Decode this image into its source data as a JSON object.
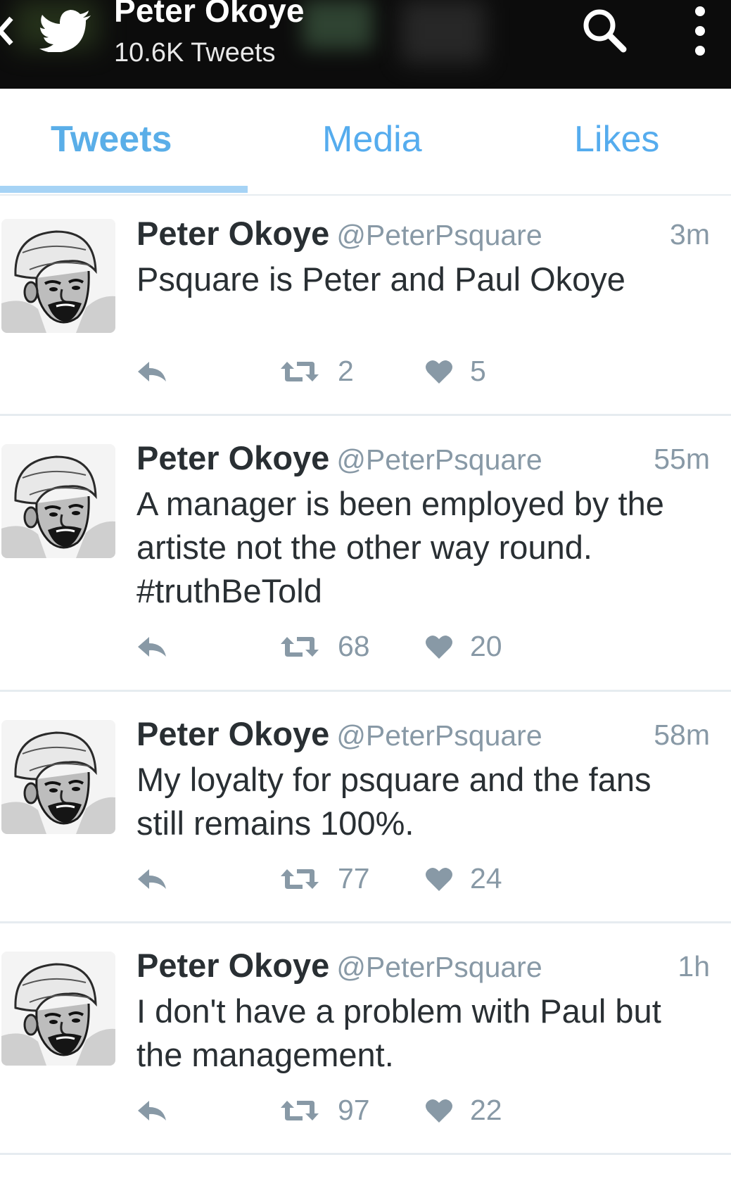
{
  "header": {
    "name": "Peter Okoye",
    "tweet_count": "10.6K Tweets",
    "icons": [
      "back-icon",
      "twitter-bird-icon",
      "search-icon",
      "more-vertical-icon"
    ]
  },
  "tabs": [
    {
      "label": "Tweets",
      "active": true
    },
    {
      "label": "Media",
      "active": false
    },
    {
      "label": "Likes",
      "active": false
    }
  ],
  "colors": {
    "accent": "#55acee",
    "text": "#292f33",
    "muted": "#8899a6",
    "divider": "#e6ecf0",
    "header_bg": "#0c0c0c"
  },
  "tweets": [
    {
      "name": "Peter Okoye",
      "handle": "@PeterPsquare",
      "time": "3m",
      "text": [
        "Psquare is Peter and Paul Okoye"
      ],
      "retweets": "2",
      "likes": "5"
    },
    {
      "name": "Peter Okoye",
      "handle": "@PeterPsquare",
      "time": "55m",
      "text": [
        "A manager is been employed by the",
        "artiste not the other way round.",
        "#truthBeTold"
      ],
      "retweets": "68",
      "likes": "20"
    },
    {
      "name": "Peter Okoye",
      "handle": "@PeterPsquare",
      "time": "58m",
      "text": [
        "My loyalty for psquare and the fans",
        "still remains 100%."
      ],
      "retweets": "77",
      "likes": "24"
    },
    {
      "name": "Peter Okoye",
      "handle": "@PeterPsquare",
      "time": "1h",
      "text": [
        "I don't have a problem with Paul but",
        "the management."
      ],
      "retweets": "97",
      "likes": "22"
    }
  ]
}
